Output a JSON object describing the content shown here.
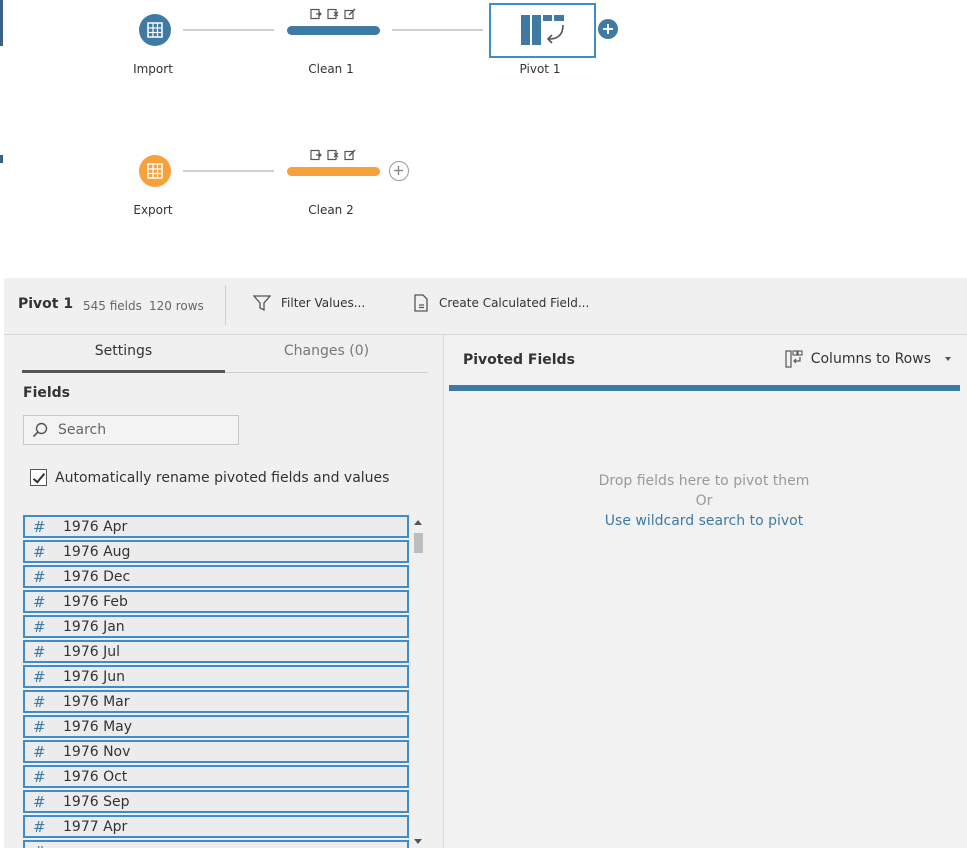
{
  "flow": {
    "nodes": {
      "import": {
        "label": "Import",
        "icon": "table-icon",
        "color": "#3f7aa5"
      },
      "clean1": {
        "label": "Clean 1",
        "color": "#3f7aa5"
      },
      "pivot1": {
        "label": "Pivot 1",
        "icon": "pivot-icon"
      },
      "export": {
        "label": "Export",
        "icon": "table-icon",
        "color": "#f6a13c"
      },
      "clean2": {
        "label": "Clean 2",
        "color": "#f6a13c"
      }
    }
  },
  "toolbar": {
    "title": "Pivot 1",
    "fields": "545 fields",
    "rows": "120 rows",
    "filter_label": "Filter Values...",
    "calc_label": "Create Calculated Field..."
  },
  "settings": {
    "tabs": [
      {
        "label": "Settings",
        "active": true
      },
      {
        "label": "Changes (0)",
        "active": false
      }
    ],
    "fields_heading": "Fields",
    "search_placeholder": "Search",
    "auto_rename_label": "Automatically rename pivoted fields and values",
    "auto_rename_checked": true,
    "fields": [
      "1976 Apr",
      "1976 Aug",
      "1976 Dec",
      "1976 Feb",
      "1976 Jan",
      "1976 Jul",
      "1976 Jun",
      "1976 Mar",
      "1976 May",
      "1976 Nov",
      "1976 Oct",
      "1976 Sep",
      "1977 Apr"
    ]
  },
  "pivoted": {
    "title": "Pivoted Fields",
    "mode_label": "Columns to Rows",
    "drop_message": "Drop fields here to pivot them",
    "or_label": "Or",
    "wildcard_link": "Use wildcard search to pivot"
  },
  "colors": {
    "accent": "#3f7aa5",
    "selection": "#3f8ccd",
    "orange": "#f6a13c"
  }
}
